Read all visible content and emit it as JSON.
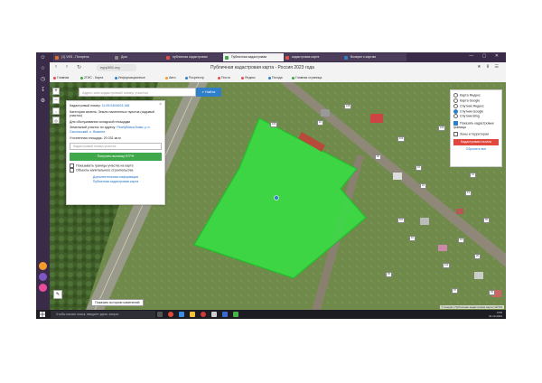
{
  "tabs": [
    {
      "label": "(1) VKS - Погорель",
      "color": "#e06c2f"
    },
    {
      "label": "Дом",
      "color": "#888888"
    },
    {
      "label": "публичная кадастровая",
      "color": "#e05050"
    },
    {
      "label": "Публичная кадастровая",
      "color": "#3ea84a",
      "active": true
    },
    {
      "label": "кадастровая карта",
      "color": "#e05050"
    },
    {
      "label": "Возврат к картам",
      "color": "#2f7fcb"
    }
  ],
  "address": {
    "url": "egrp365.org",
    "page_title": "Публичная кадастровая карта - Россия 2023 года"
  },
  "bookmarks": [
    "Главная",
    "2ГИС - Карта",
    "Информационные",
    "Авто",
    "Росреестр",
    "Почта",
    "Яндекс",
    "Погода",
    "Главная страница"
  ],
  "search": {
    "placeholder": "Адрес или кадастровый номер участка",
    "button": "Найти"
  },
  "panel": {
    "cad_label": "Кадастровый номер:",
    "cad_value": "11:09:0404003:168",
    "category": "Категория земель: Земли населенных пунктов (садовый участок)",
    "use": "Для обслуживания складской площадки",
    "neighbors_label": "Земельный участок по адресу:",
    "address_value": "Республика Коми, р-н Сысольский, с. Визинга",
    "area_label": "Уточненная площадь:",
    "area_value": "20 031 кв.м",
    "input_placeholder": "Кадастровый номер участка",
    "get_button": "Получить выписку ЕГРН",
    "check1": "Показывать границы участка на карте",
    "check2": "Объекты капитального строительства",
    "link1": "Дополнительная информация",
    "link2": "Публичная кадастровая карта"
  },
  "layers": {
    "options": [
      "Карта Яндекс",
      "Карта Google",
      "Спутник Яндекс",
      "Спутник Google",
      "Спутник Bing"
    ],
    "selected": "Спутник Google",
    "check_cad": "Показать кадастровые границы",
    "check_zones": "Зоны и территории",
    "red_button": "Кадастровая палата",
    "link": "Сбросить все"
  },
  "tooltip": "Показать историю изменений",
  "copyright": "© Google | Публичная кадастровая карта | ЕГРН",
  "taskbar": {
    "search_placeholder": "Чтобы начать поиск, введите здесь запрос",
    "time": "9:55",
    "date": "31.10.2023"
  },
  "map_labels": [
    "103",
    "10",
    "108",
    "110",
    "20",
    "16",
    "24",
    "111",
    "10",
    "122",
    "13",
    "29",
    "97",
    "32",
    "33",
    "14",
    "102",
    "25",
    "31"
  ],
  "colors": {
    "parcel": "#35e243",
    "accent": "#2f7fcb",
    "red": "#e0483e",
    "green_button": "#3ea84a"
  }
}
